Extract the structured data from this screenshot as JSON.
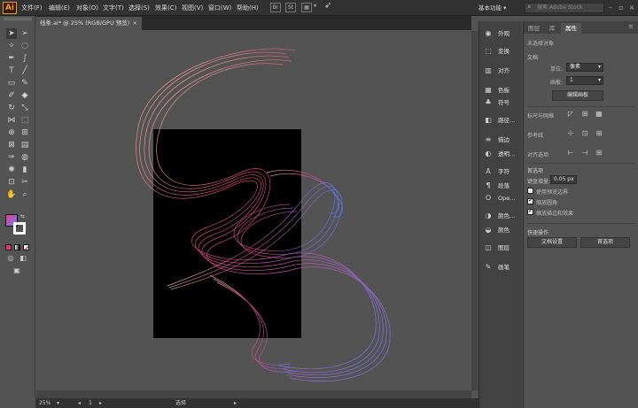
{
  "app": {
    "logo": "Ai"
  },
  "menu": [
    "文件(F)",
    "编辑(E)",
    "对象(O)",
    "文字(T)",
    "选择(S)",
    "效果(C)",
    "视图(V)",
    "窗口(W)",
    "帮助(H)"
  ],
  "toolbar_buttons": [
    "Br",
    "St"
  ],
  "workspace": "基本功能",
  "search": {
    "placeholder": "搜索 Adobe Stock"
  },
  "document": {
    "tab_title": "线条.ai* @ 25% (RGB/GPU 预览)",
    "close_glyph": "×"
  },
  "status": {
    "zoom": "25%",
    "mode": "选择",
    "page": "1"
  },
  "panels_left": [
    {
      "icon": "appearance-icon",
      "glyph": "◉",
      "label": "外观"
    },
    {
      "icon": "transform-icon",
      "glyph": "⬚",
      "label": "变换"
    },
    {
      "icon": "align-icon",
      "glyph": "▥",
      "label": "对齐"
    },
    {
      "icon": "swatches-icon",
      "glyph": "▦",
      "label": "色板"
    },
    {
      "icon": "symbols-icon",
      "glyph": "♣",
      "label": "符号"
    },
    {
      "icon": "pathfinder-icon",
      "glyph": "◧",
      "label": "路径..."
    },
    {
      "icon": "stroke-icon",
      "glyph": "≡",
      "label": "描边"
    },
    {
      "icon": "transparency-icon",
      "glyph": "◐",
      "label": "透明..."
    },
    {
      "icon": "character-icon",
      "glyph": "A",
      "label": "字符"
    },
    {
      "icon": "paragraph-icon",
      "glyph": "¶",
      "label": "段落"
    },
    {
      "icon": "opentype-icon",
      "glyph": "O",
      "label": "Ope..."
    },
    {
      "icon": "color-icon",
      "glyph": "◑",
      "label": "颜色..."
    },
    {
      "icon": "color2-icon",
      "glyph": "◒",
      "label": "颜色"
    },
    {
      "icon": "layers-icon",
      "glyph": "◫",
      "label": "图层"
    },
    {
      "icon": "brushes-icon",
      "glyph": "✎",
      "label": "画笔"
    }
  ],
  "properties": {
    "tabs": [
      "图层",
      "库",
      "属性"
    ],
    "active_tab": 2,
    "no_selection": "未选择对象",
    "doc_section": "文档",
    "unit_label": "单位:",
    "unit_value": "像素",
    "artboard_label": "画板:",
    "artboard_value": "1",
    "edit_artboard": "编辑画板",
    "snap_label": "标尺与网格",
    "guides_label": "参考线",
    "snap_options": "对齐选项",
    "prefs_section": "首选项",
    "keyboard_increment_label": "键盘增量:",
    "keyboard_increment_value": "0.05 px",
    "options": [
      {
        "label": "使用预览边界",
        "checked": false
      },
      {
        "label": "缩放圆角",
        "checked": true
      },
      {
        "label": "缩放描边和效果",
        "checked": true
      }
    ],
    "quick_actions": "快速操作",
    "doc_setup": "文档设置",
    "preferences": "首选项"
  }
}
